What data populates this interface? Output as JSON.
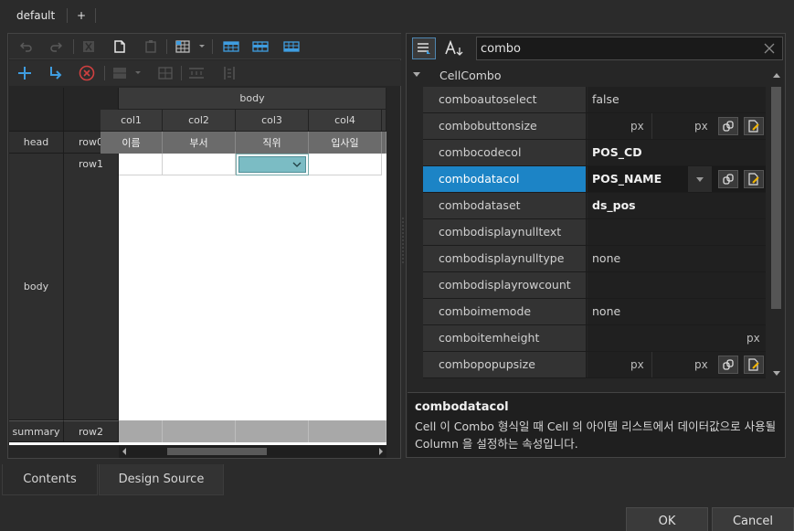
{
  "tabs": {
    "active": "default",
    "add": "+"
  },
  "grid": {
    "band_label": "body",
    "columns": [
      "col1",
      "col2",
      "col3",
      "col4"
    ],
    "head_row": {
      "band": "head",
      "row": "row0",
      "cells": [
        "이름",
        "부서",
        "직위",
        "입사일"
      ]
    },
    "body_row": {
      "band": "body",
      "row": "row1"
    },
    "summary_row": {
      "band": "summary",
      "row": "row2"
    }
  },
  "search": {
    "value": "combo"
  },
  "properties": {
    "category": "CellCombo",
    "unit": "px",
    "rows": [
      {
        "name": "comboautoselect",
        "value": "false"
      },
      {
        "name": "combobuttonsize",
        "value": ""
      },
      {
        "name": "combocodecol",
        "value": "POS_CD"
      },
      {
        "name": "combodatacol",
        "value": "POS_NAME"
      },
      {
        "name": "combodataset",
        "value": "ds_pos"
      },
      {
        "name": "combodisplaynulltext",
        "value": ""
      },
      {
        "name": "combodisplaynulltype",
        "value": "none"
      },
      {
        "name": "combodisplayrowcount",
        "value": ""
      },
      {
        "name": "comboimemode",
        "value": "none"
      },
      {
        "name": "comboitemheight",
        "value": ""
      },
      {
        "name": "combopopupsize",
        "value": ""
      }
    ]
  },
  "description": {
    "title": "combodatacol",
    "text": "Cell 이 Combo 형식일 때 Cell 의 아이템 리스트에서 데이터값으로 사용될 Column 을 설정하는 속성입니다."
  },
  "bottom_tabs": {
    "contents": "Contents",
    "design_source": "Design Source"
  },
  "buttons": {
    "ok": "OK",
    "cancel": "Cancel"
  },
  "colors": {
    "accent": "#1c84c6",
    "icon_blue": "#3f9de0",
    "stop_red": "#d04040",
    "combo_cell": "#7bbcc4"
  }
}
